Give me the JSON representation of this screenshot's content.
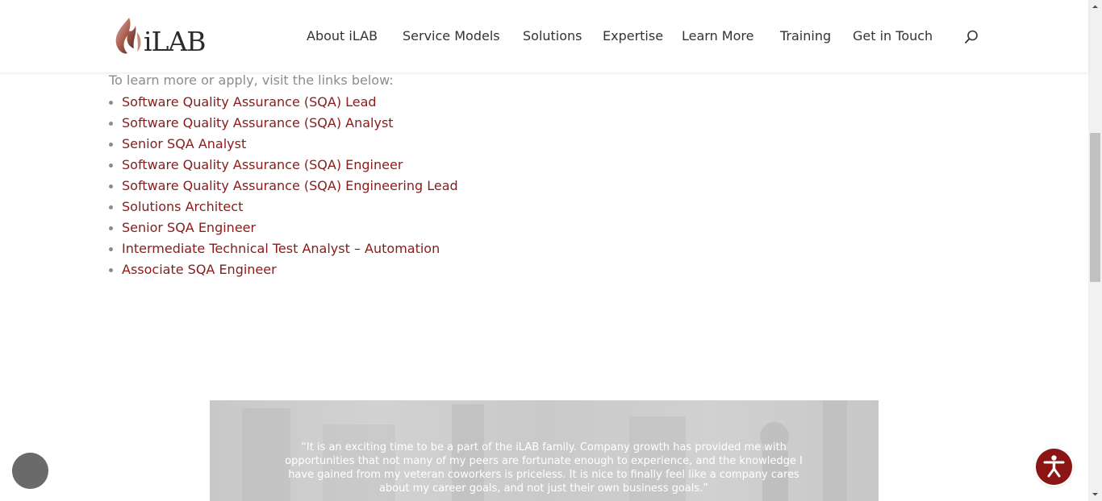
{
  "header": {
    "logo_text": "iLAB",
    "nav": [
      {
        "label": "About iLAB"
      },
      {
        "label": "Service Models"
      },
      {
        "label": "Solutions"
      },
      {
        "label": "Expertise"
      },
      {
        "label": "Learn More"
      },
      {
        "label": "Training"
      },
      {
        "label": "Get in Touch"
      }
    ],
    "search_icon": "search-icon"
  },
  "content": {
    "intro": "To learn more or apply, visit the links below:",
    "jobs": [
      {
        "label": "Software Quality Assurance (SQA) Lead"
      },
      {
        "label": "Software Quality Assurance (SQA) Analyst"
      },
      {
        "label": "Senior SQA Analyst"
      },
      {
        "label": "Software Quality Assurance (SQA) Engineer"
      },
      {
        "label": "Software Quality Assurance (SQA) Engineering Lead"
      },
      {
        "label": "Solutions Architect"
      },
      {
        "label": "Senior SQA Engineer"
      },
      {
        "label": "Intermediate Technical Test Analyst – Automation"
      },
      {
        "label": "Associate SQA Engineer"
      }
    ]
  },
  "testimonial": {
    "quote": "“It is an exciting time to be a part of the iLAB family. Company growth has provided me with opportunities that not many of my peers are fortunate enough to experience, and the knowledge I have gained from my veteran coworkers is priceless. It is nice to finally feel like a company cares about my career goals, and not just their own business goals.”"
  },
  "floating": {
    "accessibility_icon": "accessibility-icon"
  },
  "colors": {
    "link": "#8b1a1a",
    "nav_text": "#333333",
    "muted_text": "#8c8c8c",
    "accessibility_bg": "#8b1414",
    "chat_bg": "#6a6a6a"
  }
}
